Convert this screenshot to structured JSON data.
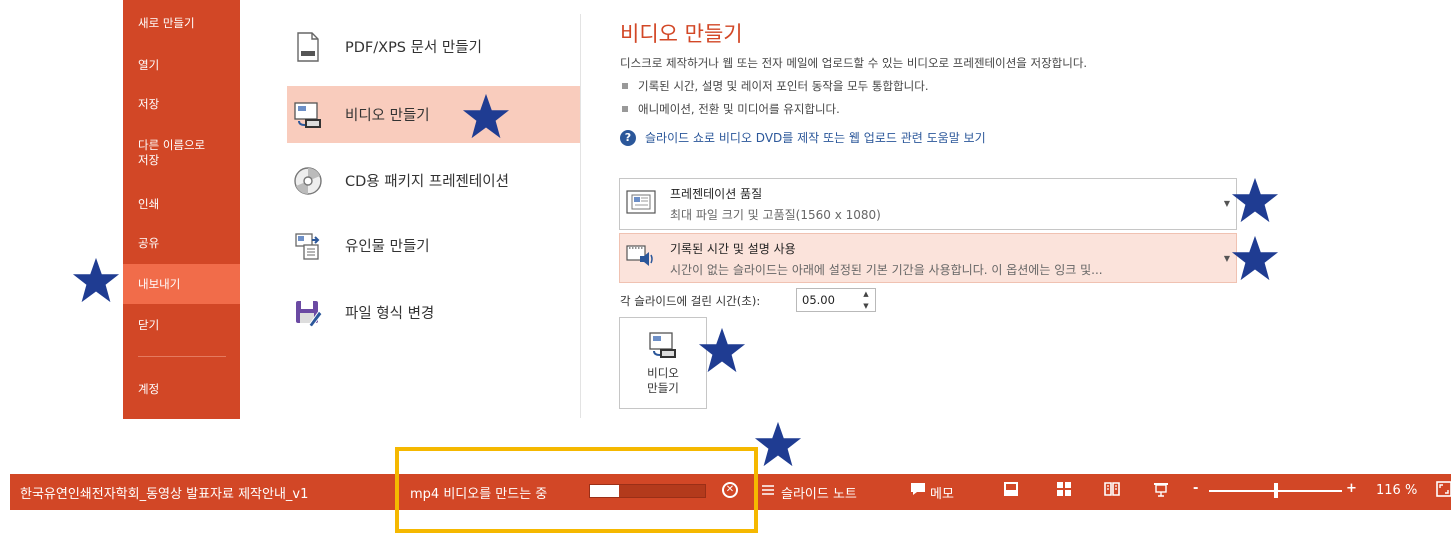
{
  "sidebar": {
    "items": [
      {
        "label": "새로 만들기"
      },
      {
        "label": "열기"
      },
      {
        "label": "저장"
      },
      {
        "label": "다른 이름으로\n저장"
      },
      {
        "label": "인쇄"
      },
      {
        "label": "공유"
      },
      {
        "label": "내보내기",
        "active": true
      },
      {
        "label": "닫기"
      },
      {
        "label": "계정"
      }
    ]
  },
  "export_options": [
    {
      "label": "PDF/XPS 문서 만들기",
      "icon": "pdf-document-icon"
    },
    {
      "label": "비디오 만들기",
      "icon": "video-icon",
      "active": true
    },
    {
      "label": "CD용 패키지 프레젠테이션",
      "icon": "cd-icon"
    },
    {
      "label": "유인물 만들기",
      "icon": "handout-icon"
    },
    {
      "label": "파일 형식 변경",
      "icon": "save-as-icon"
    }
  ],
  "panel": {
    "title": "비디오 만들기",
    "description": "디스크로 제작하거나 웹 또는 전자 메일에 업로드할 수 있는 비디오로 프레젠테이션을 저장합니다.",
    "bullets": [
      "기록된 시간, 설명 및 레이저 포인터 동작을 모두 통합합니다.",
      "애니메이션, 전환 및 미디어를 유지합니다."
    ],
    "help_link": "슬라이드 쇼로 비디오 DVD를 제작 또는 웹 업로드 관련 도움말 보기",
    "quality": {
      "title": "프레젠테이션 품질",
      "subtitle": "최대 파일 크기 및 고품질(1560 x 1080)"
    },
    "timings": {
      "title": "기록된 시간 및 설명 사용",
      "subtitle": "시간이 없는 슬라이드는 아래에 설정된 기본 기간을 사용합니다. 이 옵션에는 잉크 및..."
    },
    "seconds_label": "각 슬라이드에 걸린 시간(초):",
    "seconds_value": "05.00",
    "create_button": "비디오\n만들기"
  },
  "statusbar": {
    "filename": "한국유연인쇄전자학회_동영상 발표자료 제작안내_v1",
    "progress_text": "mp4 비디오를 만드는 중",
    "progress_fraction": 0.25,
    "notes_label": "슬라이드 노트",
    "comments_label": "메모",
    "zoom_fraction": 0.5,
    "zoom_minus": "-",
    "zoom_plus": "+",
    "zoom_level": "116 %"
  },
  "colors": {
    "accent": "#d24726",
    "star": "#1f3c92",
    "highlight": "#f5b800"
  }
}
